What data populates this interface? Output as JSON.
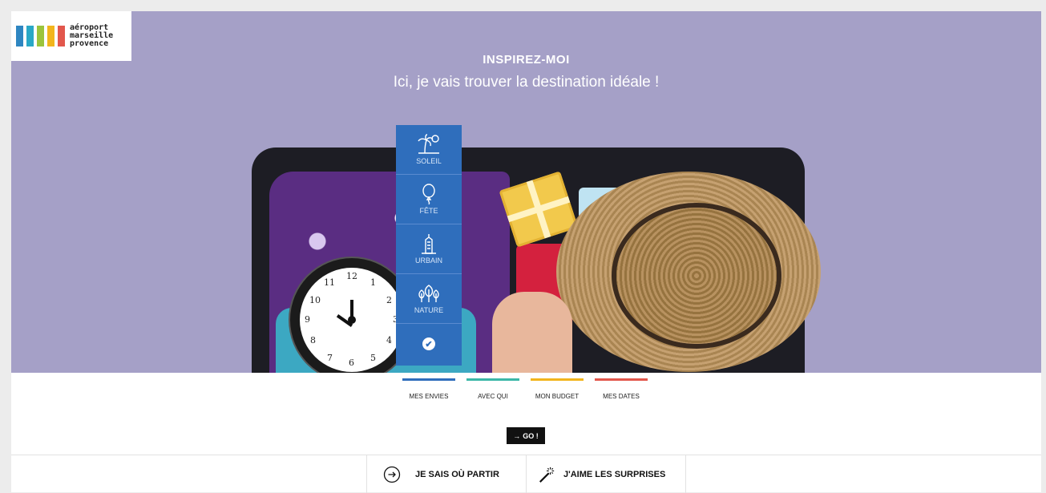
{
  "brand": {
    "lines": [
      "aéroport",
      "marseille",
      "provence"
    ],
    "bar_colors": [
      "#2e86c1",
      "#29a8c6",
      "#9bc43c",
      "#f2b51c",
      "#e2574c"
    ]
  },
  "hero": {
    "title": "INSPIREZ-MOI",
    "subtitle": "Ici, je vais trouver la destination idéale !"
  },
  "categories": [
    {
      "label": "SOLEIL",
      "icon": "palm-sun-icon"
    },
    {
      "label": "FÊTE",
      "icon": "balloon-icon"
    },
    {
      "label": "URBAIN",
      "icon": "building-icon"
    },
    {
      "label": "NATURE",
      "icon": "trees-icon"
    }
  ],
  "steps": [
    {
      "label": "MES ENVIES",
      "color": "#2f6ebc"
    },
    {
      "label": "AVEC QUI",
      "color": "#3bb7a8"
    },
    {
      "label": "MON BUDGET",
      "color": "#f2b51c"
    },
    {
      "label": "MES DATES",
      "color": "#e2574c"
    }
  ],
  "go_label": "GO !",
  "options": [
    {
      "label": "JE SAIS OÙ PARTIR",
      "icon": "arrow-circle-icon"
    },
    {
      "label": "J'AIME LES SURPRISES",
      "icon": "magic-wand-icon"
    }
  ],
  "clock_numbers": [
    "12",
    "1",
    "2",
    "3",
    "4",
    "5",
    "6",
    "7",
    "8",
    "9",
    "10",
    "11"
  ]
}
